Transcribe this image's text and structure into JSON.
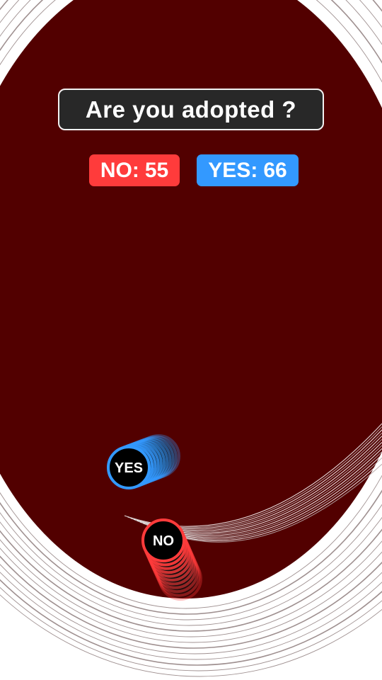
{
  "question": {
    "text": "Are you adopted ?"
  },
  "scores": {
    "no": {
      "label": "NO:",
      "value": "55",
      "color": "#ff3b3b"
    },
    "yes": {
      "label": "YES:",
      "value": "66",
      "color": "#3399ff"
    }
  },
  "balls": {
    "yes": {
      "label": "YES",
      "color": "#3399ff",
      "fill": "#000000"
    },
    "no": {
      "label": "NO",
      "color": "#ff3b3b",
      "fill": "#000000"
    }
  },
  "arena": {
    "background_color": "#520000",
    "ring_color": "#ffffff"
  }
}
